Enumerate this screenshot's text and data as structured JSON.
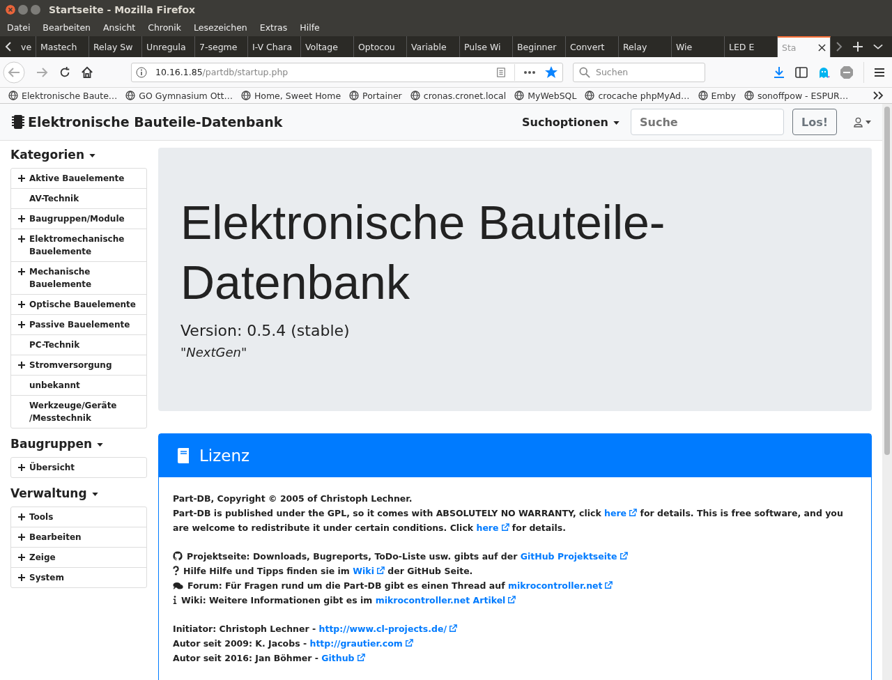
{
  "window": {
    "title": "Startseite - Mozilla Firefox"
  },
  "menu": [
    "Datei",
    "Bearbeiten",
    "Ansicht",
    "Chronik",
    "Lesezeichen",
    "Extras",
    "Hilfe"
  ],
  "tabs": [
    {
      "label": "ve",
      "selected": false
    },
    {
      "label": "Mastech",
      "selected": false
    },
    {
      "label": "Relay Sw",
      "selected": false
    },
    {
      "label": "Unregula",
      "selected": false
    },
    {
      "label": "7-segme",
      "selected": false
    },
    {
      "label": "I-V Chara",
      "selected": false
    },
    {
      "label": "Voltage",
      "selected": false
    },
    {
      "label": "Optocou",
      "selected": false
    },
    {
      "label": "Variable",
      "selected": false
    },
    {
      "label": "Pulse Wi",
      "selected": false
    },
    {
      "label": "Beginner",
      "selected": false
    },
    {
      "label": "Convert",
      "selected": false
    },
    {
      "label": "Relay",
      "selected": false
    },
    {
      "label": "Wie",
      "selected": false
    },
    {
      "label": "LED E",
      "selected": false
    },
    {
      "label": "Sta",
      "selected": true
    }
  ],
  "url": {
    "host": "10.16.1.85",
    "path": "/partdb/startup.php"
  },
  "browser_search": {
    "placeholder": "Suchen"
  },
  "bookmarks": [
    "Elektronische Baute…",
    "GO Gymnasium Ott…",
    "Home, Sweet Home",
    "Portainer",
    "cronas.cronet.local",
    "MyWebSQL",
    "crocache phpMyAd…",
    "Emby",
    "sonoffpow - ESPUR…"
  ],
  "navbar": {
    "brand": "Elektronische Bauteile-Datenbank",
    "search_options": "Suchoptionen",
    "search": {
      "placeholder": "Suche"
    },
    "go": "Los!"
  },
  "sidebar": [
    {
      "heading": "Kategorien",
      "items": [
        {
          "label": "Aktive Bauelemente",
          "expandable": true
        },
        {
          "label": "AV-Technik",
          "expandable": false
        },
        {
          "label": "Baugruppen/Module",
          "expandable": true
        },
        {
          "label": "Elektromechanische Bauelemente",
          "expandable": true
        },
        {
          "label": "Mechanische Bauelemente",
          "expandable": true
        },
        {
          "label": "Optische Bauelemente",
          "expandable": true
        },
        {
          "label": "Passive Bauelemente",
          "expandable": true
        },
        {
          "label": "PC-Technik",
          "expandable": false
        },
        {
          "label": "Stromversorgung",
          "expandable": true
        },
        {
          "label": "unbekannt",
          "expandable": false
        },
        {
          "label": "Werkzeuge/Geräte /Messtechnik",
          "expandable": false
        }
      ]
    },
    {
      "heading": "Baugruppen",
      "items": [
        {
          "label": "Übersicht",
          "expandable": true
        }
      ]
    },
    {
      "heading": "Verwaltung",
      "items": [
        {
          "label": "Tools",
          "expandable": true
        },
        {
          "label": "Bearbeiten",
          "expandable": true
        },
        {
          "label": "Zeige",
          "expandable": true
        },
        {
          "label": "System",
          "expandable": true
        }
      ]
    }
  ],
  "jumbotron": {
    "title": "Elektronische Bauteile-Datenbank",
    "version": "Version: 0.5.4 (stable)",
    "codename": "\"NextGen\""
  },
  "license": {
    "title": "Lizenz",
    "blocks": [
      [
        {
          "kind": "plain",
          "parts": [
            {
              "text": "Part-DB, Copyright © 2005 of Christoph Lechner."
            }
          ]
        },
        {
          "kind": "plain",
          "parts": [
            {
              "text": "Part-DB is published under the GPL, so it comes with ABSOLUTELY NO WARRANTY, click "
            },
            {
              "text": "here",
              "link": true
            },
            {
              "text": " for details. This is free software, and you are welcome to redistribute it under certain conditions. Click "
            },
            {
              "text": "here",
              "link": true
            },
            {
              "text": " for details."
            }
          ]
        }
      ],
      [
        {
          "kind": "github",
          "parts": [
            {
              "text": "Projektseite: Downloads, Bugreports, ToDo-Liste usw. gibts auf der "
            },
            {
              "text": "GitHub Projektseite",
              "link": true
            }
          ]
        },
        {
          "kind": "help",
          "parts": [
            {
              "text": "Hilfe Hilfe und Tipps finden sie im "
            },
            {
              "text": "Wiki",
              "link": true
            },
            {
              "text": " der GitHub Seite."
            }
          ]
        },
        {
          "kind": "forum",
          "parts": [
            {
              "text": "Forum: Für Fragen rund um die Part-DB gibt es einen Thread auf "
            },
            {
              "text": "mikrocontroller.net",
              "link": true
            }
          ]
        },
        {
          "kind": "info",
          "parts": [
            {
              "text": "Wiki: Weitere Informationen gibt es im "
            },
            {
              "text": "mikrocontroller.net Artikel",
              "link": true
            }
          ]
        }
      ],
      [
        {
          "kind": "plain",
          "parts": [
            {
              "text": "Initiator: Christoph Lechner - "
            },
            {
              "text": "http://www.cl-projects.de/",
              "link": true
            }
          ]
        },
        {
          "kind": "plain",
          "parts": [
            {
              "text": "Autor seit 2009: K. Jacobs - "
            },
            {
              "text": "http://grautier.com",
              "link": true
            }
          ]
        },
        {
          "kind": "plain",
          "parts": [
            {
              "text": "Autor seit 2016: Jan Böhmer - "
            },
            {
              "text": "Github",
              "link": true
            }
          ]
        }
      ]
    ]
  }
}
